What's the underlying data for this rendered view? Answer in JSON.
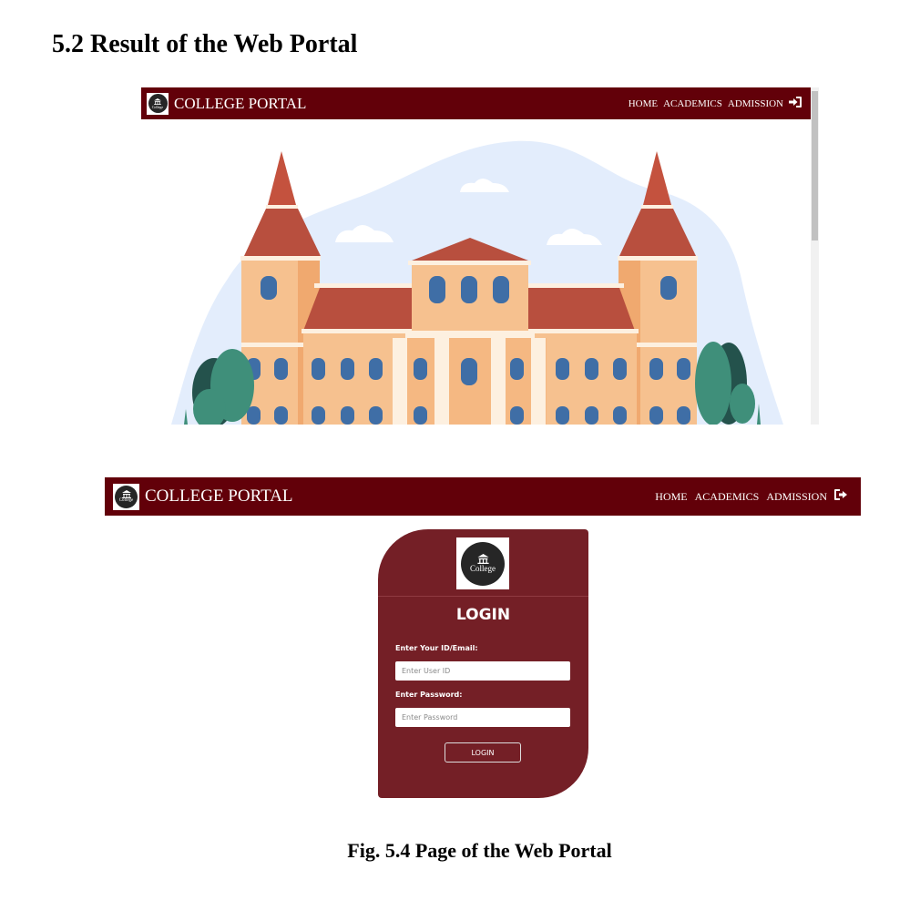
{
  "section_heading": "5.2 Result of the Web Portal",
  "navbar": {
    "brand": "COLLEGE PORTAL",
    "logo_text": "College",
    "links": [
      "HOME",
      "ACADEMICS",
      "ADMISSION"
    ],
    "colors": {
      "background": "#620009",
      "text": "#ffffff"
    }
  },
  "login": {
    "logo_text": "College",
    "title": "LOGIN",
    "id_label": "Enter Your ID/Email:",
    "id_placeholder": "Enter User ID",
    "password_label": "Enter Password:",
    "password_placeholder": "Enter Password",
    "button_label": "LOGIN",
    "colors": {
      "card": "#741f26"
    }
  },
  "icons": {
    "navbar_one": "sign-in-icon",
    "navbar_two": "sign-out-icon",
    "logo": "university-building-icon"
  },
  "caption": "Fig. 5.4 Page of the Web Portal"
}
